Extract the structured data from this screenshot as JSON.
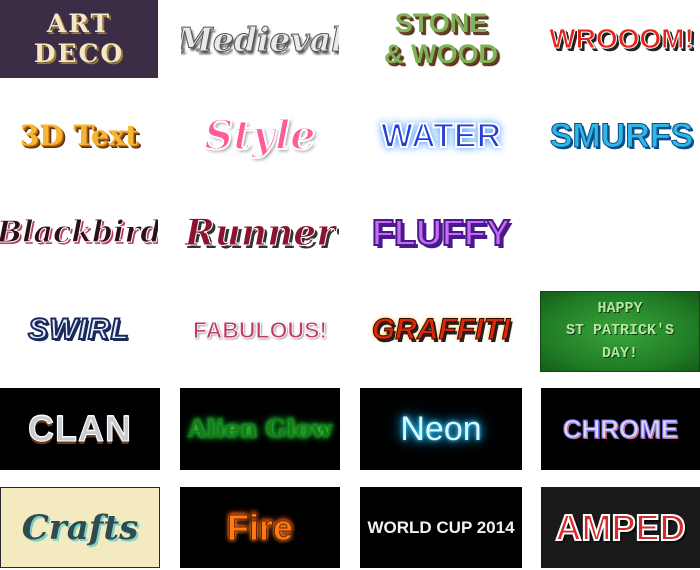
{
  "gallery": {
    "tiles": [
      {
        "label": "ART\nDECO"
      },
      {
        "label": "Medieval"
      },
      {
        "label": "STONE\n& WOOD"
      },
      {
        "label": "WROOOM!"
      },
      {
        "label": "3D Text"
      },
      {
        "label": "Style"
      },
      {
        "label": "WATER"
      },
      {
        "label": "SMURFS"
      },
      {
        "label": "Blackbird"
      },
      {
        "label": "Runner"
      },
      {
        "label": "FLUFFY"
      },
      {
        "label": "SWIRL"
      },
      {
        "label": "FABULOUS!"
      },
      {
        "label": "GRAFFITI"
      },
      {
        "label": "HAPPY\nST PATRICK'S\nDAY!"
      },
      {
        "label": "CLAN"
      },
      {
        "label": "Alien Glow"
      },
      {
        "label": "Neon"
      },
      {
        "label": "CHROME"
      },
      {
        "label": "Crafts"
      },
      {
        "label": "Fire"
      },
      {
        "label": "WORLD CUP 2014"
      },
      {
        "label": "AMPED"
      }
    ]
  }
}
